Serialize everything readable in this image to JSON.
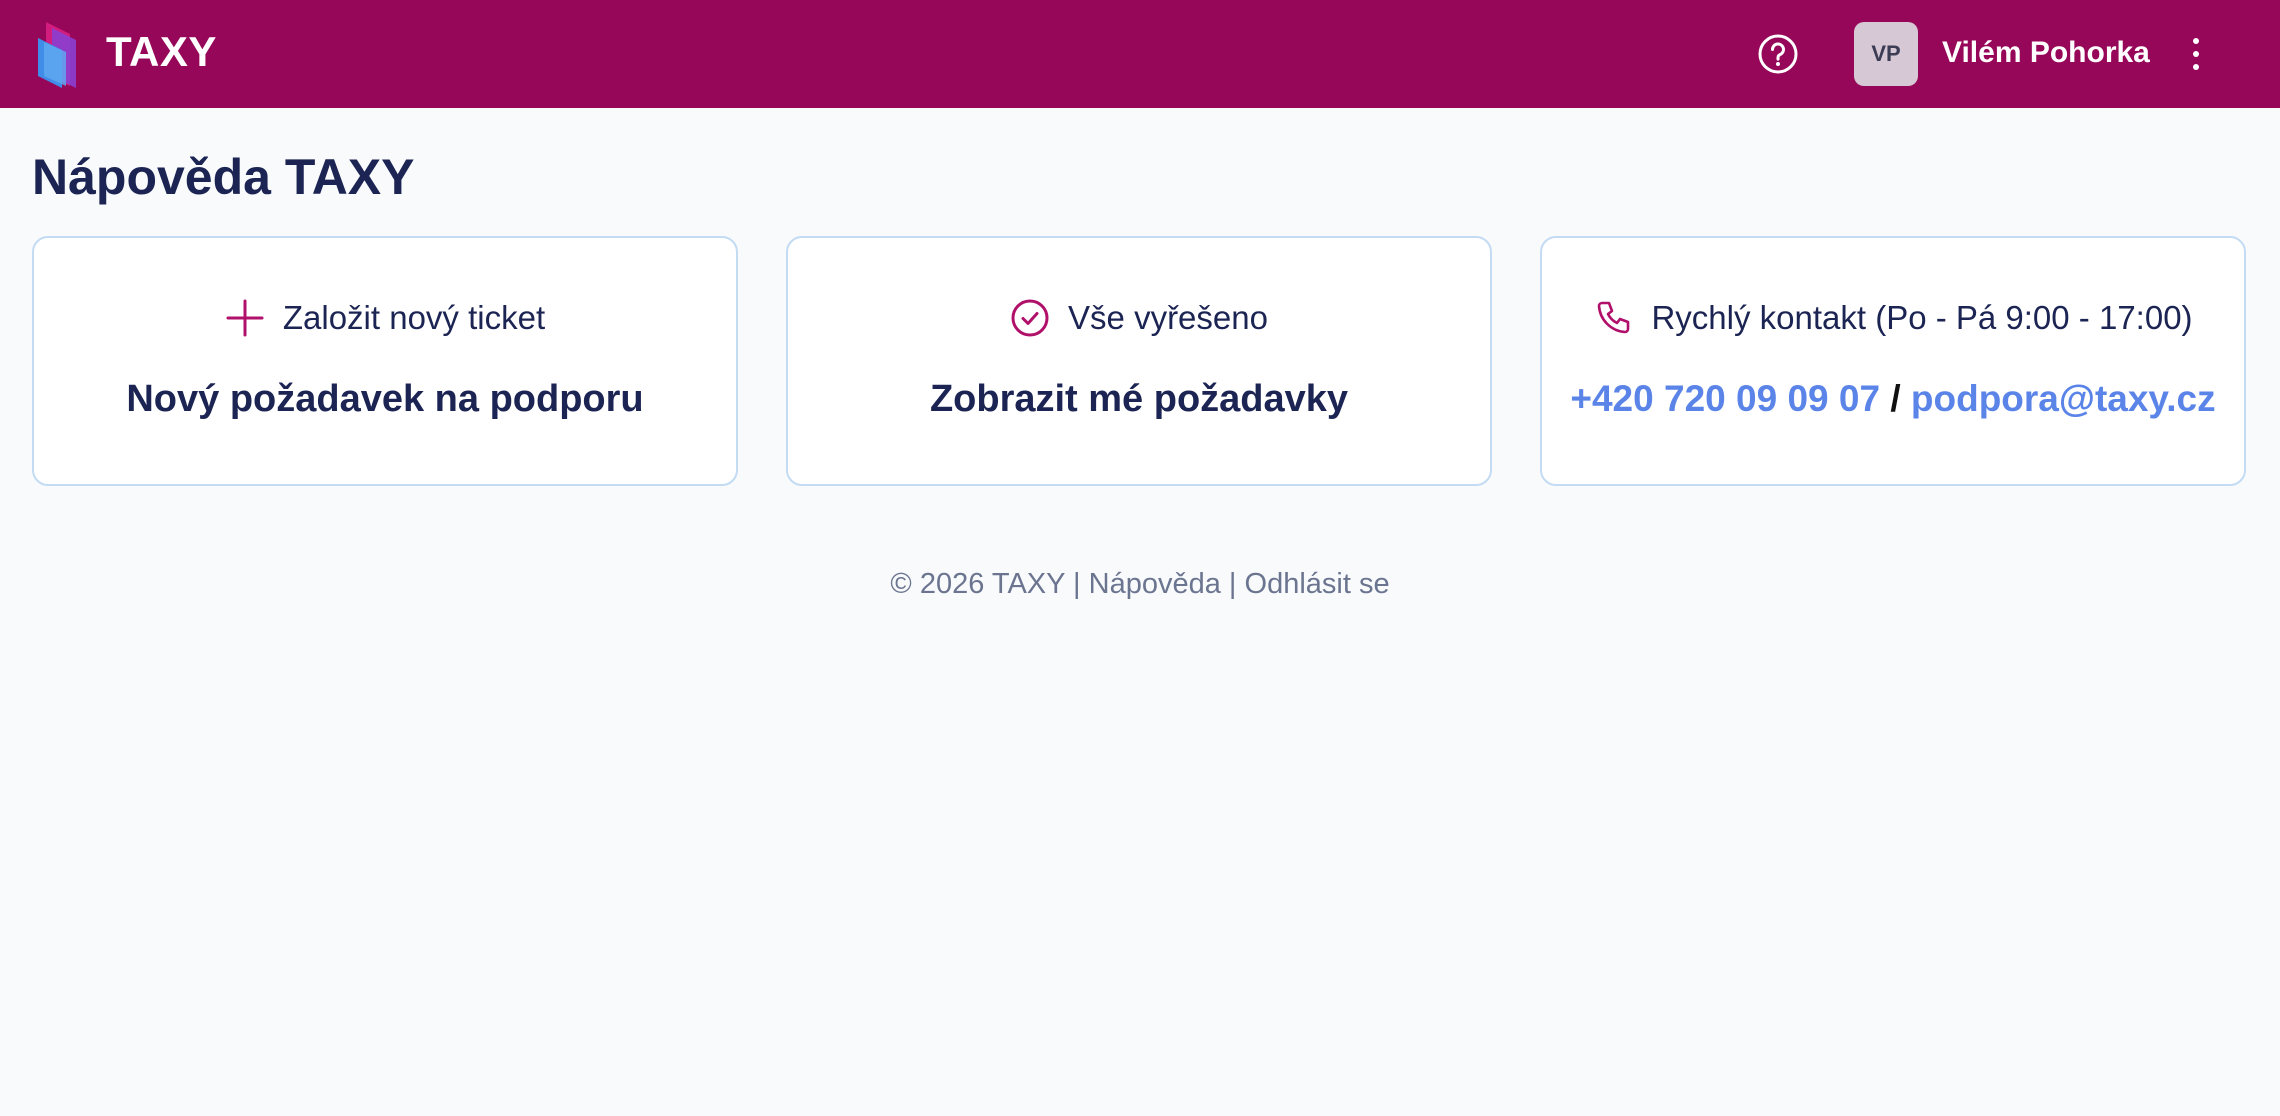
{
  "header": {
    "brand": "TAXY",
    "user_initials": "VP",
    "user_name": "Vilém Pohorka",
    "background": "#970759"
  },
  "page": {
    "title": "Nápověda TAXY"
  },
  "cards": [
    {
      "head": "Založit nový ticket",
      "main": "Nový požadavek na podporu",
      "icon": "plus-icon"
    },
    {
      "head": "Vše vyřešeno",
      "main": "Zobrazit mé požadavky",
      "icon": "check-circle-icon"
    },
    {
      "head": "Rychlý kontakt (Po - Pá 9:00 - 17:00)",
      "phone": "+420 720 09 09 07",
      "separator": "/",
      "email": "podpora@taxy.cz",
      "icon": "phone-icon"
    }
  ],
  "footer": {
    "copyright": "© 2026 TAXY",
    "divider": "|",
    "help": "Nápověda",
    "logout": "Odhlásit se"
  },
  "colors": {
    "accent": "#b0106a",
    "link": "#5b84e8",
    "text": "#1b2452"
  }
}
